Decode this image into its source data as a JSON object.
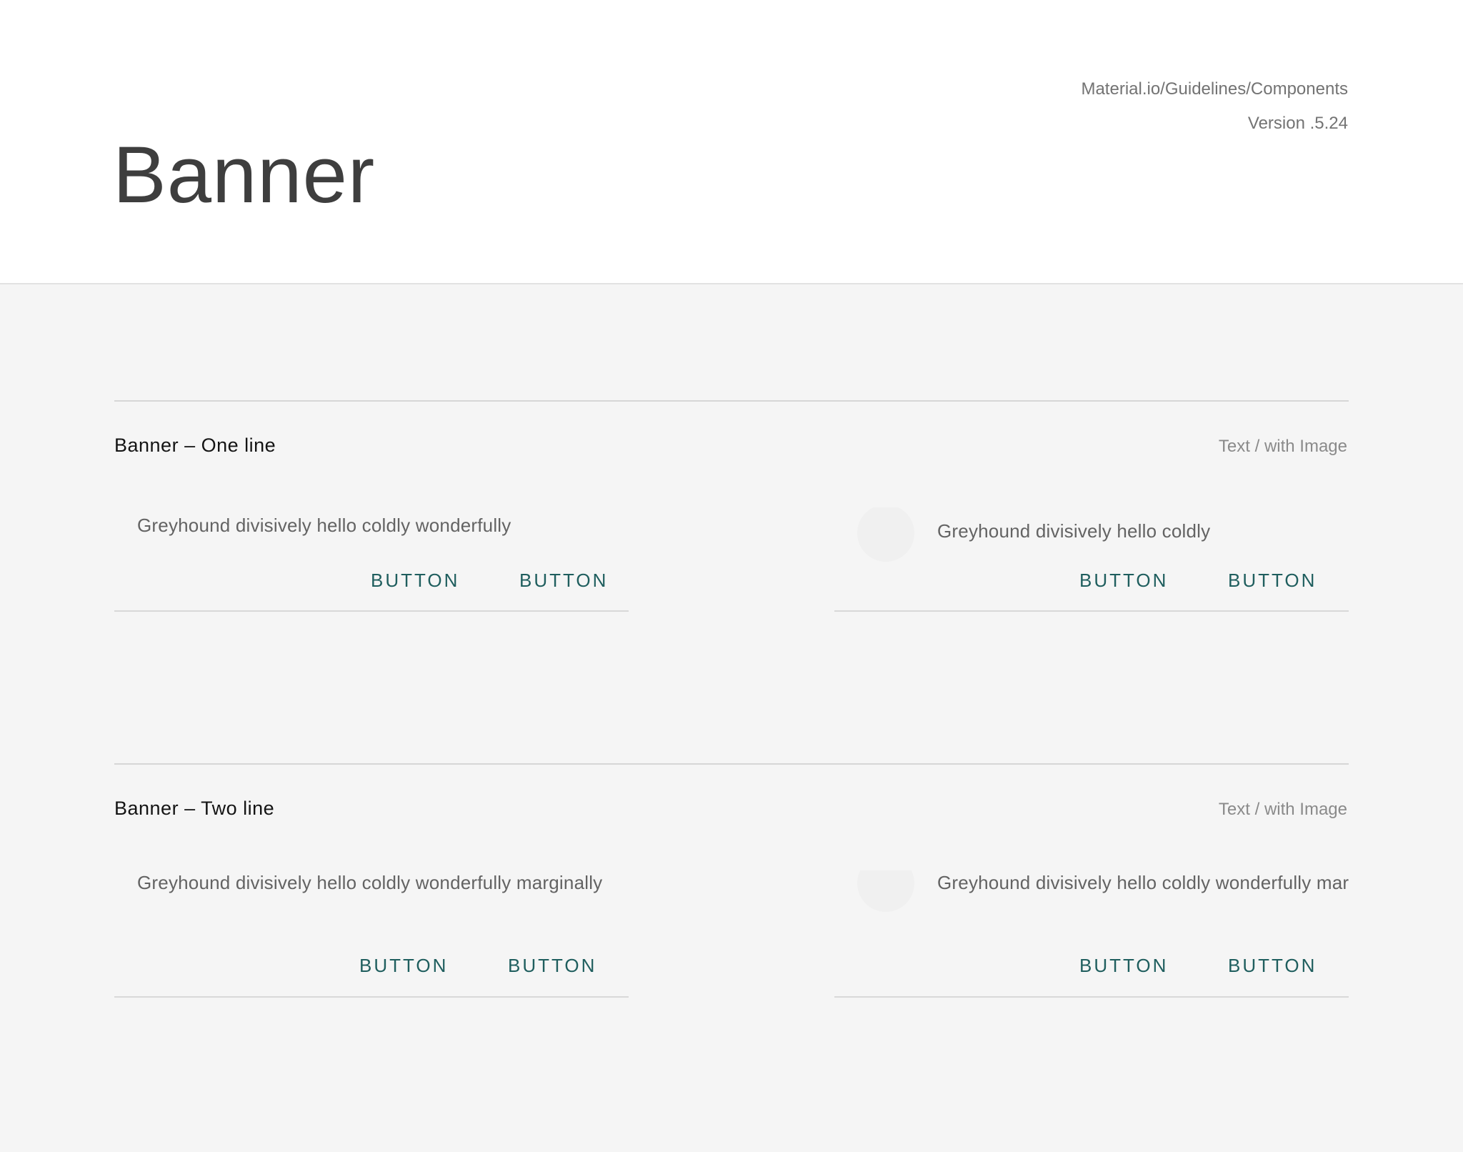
{
  "header": {
    "title": "Banner",
    "path": "Material.io/Guidelines/Components",
    "version": "Version .5.24"
  },
  "sections": [
    {
      "title": "Banner – One line",
      "variant": "Text / with Image",
      "banners": [
        {
          "text": "Greyhound divisively hello coldly wonderfully",
          "has_image": false,
          "buttons": [
            "BUTTON",
            "BUTTON"
          ]
        },
        {
          "text": "Greyhound divisively hello coldly",
          "has_image": true,
          "buttons": [
            "BUTTON",
            "BUTTON"
          ]
        }
      ]
    },
    {
      "title": "Banner – Two line",
      "variant": "Text / with Image",
      "banners": [
        {
          "text": "Greyhound divisively hello coldly wonderfully marginally",
          "has_image": false,
          "buttons": [
            "BUTTON",
            "BUTTON"
          ]
        },
        {
          "text": "Greyhound divisively hello coldly wonderfully marginally",
          "has_image": true,
          "buttons": [
            "BUTTON",
            "BUTTON"
          ]
        }
      ]
    }
  ],
  "colors": {
    "header_bg": "#ffffff",
    "canvas_bg": "#f5f5f5",
    "button_text": "#1f5e5e",
    "title_text": "#3e3e3e"
  }
}
